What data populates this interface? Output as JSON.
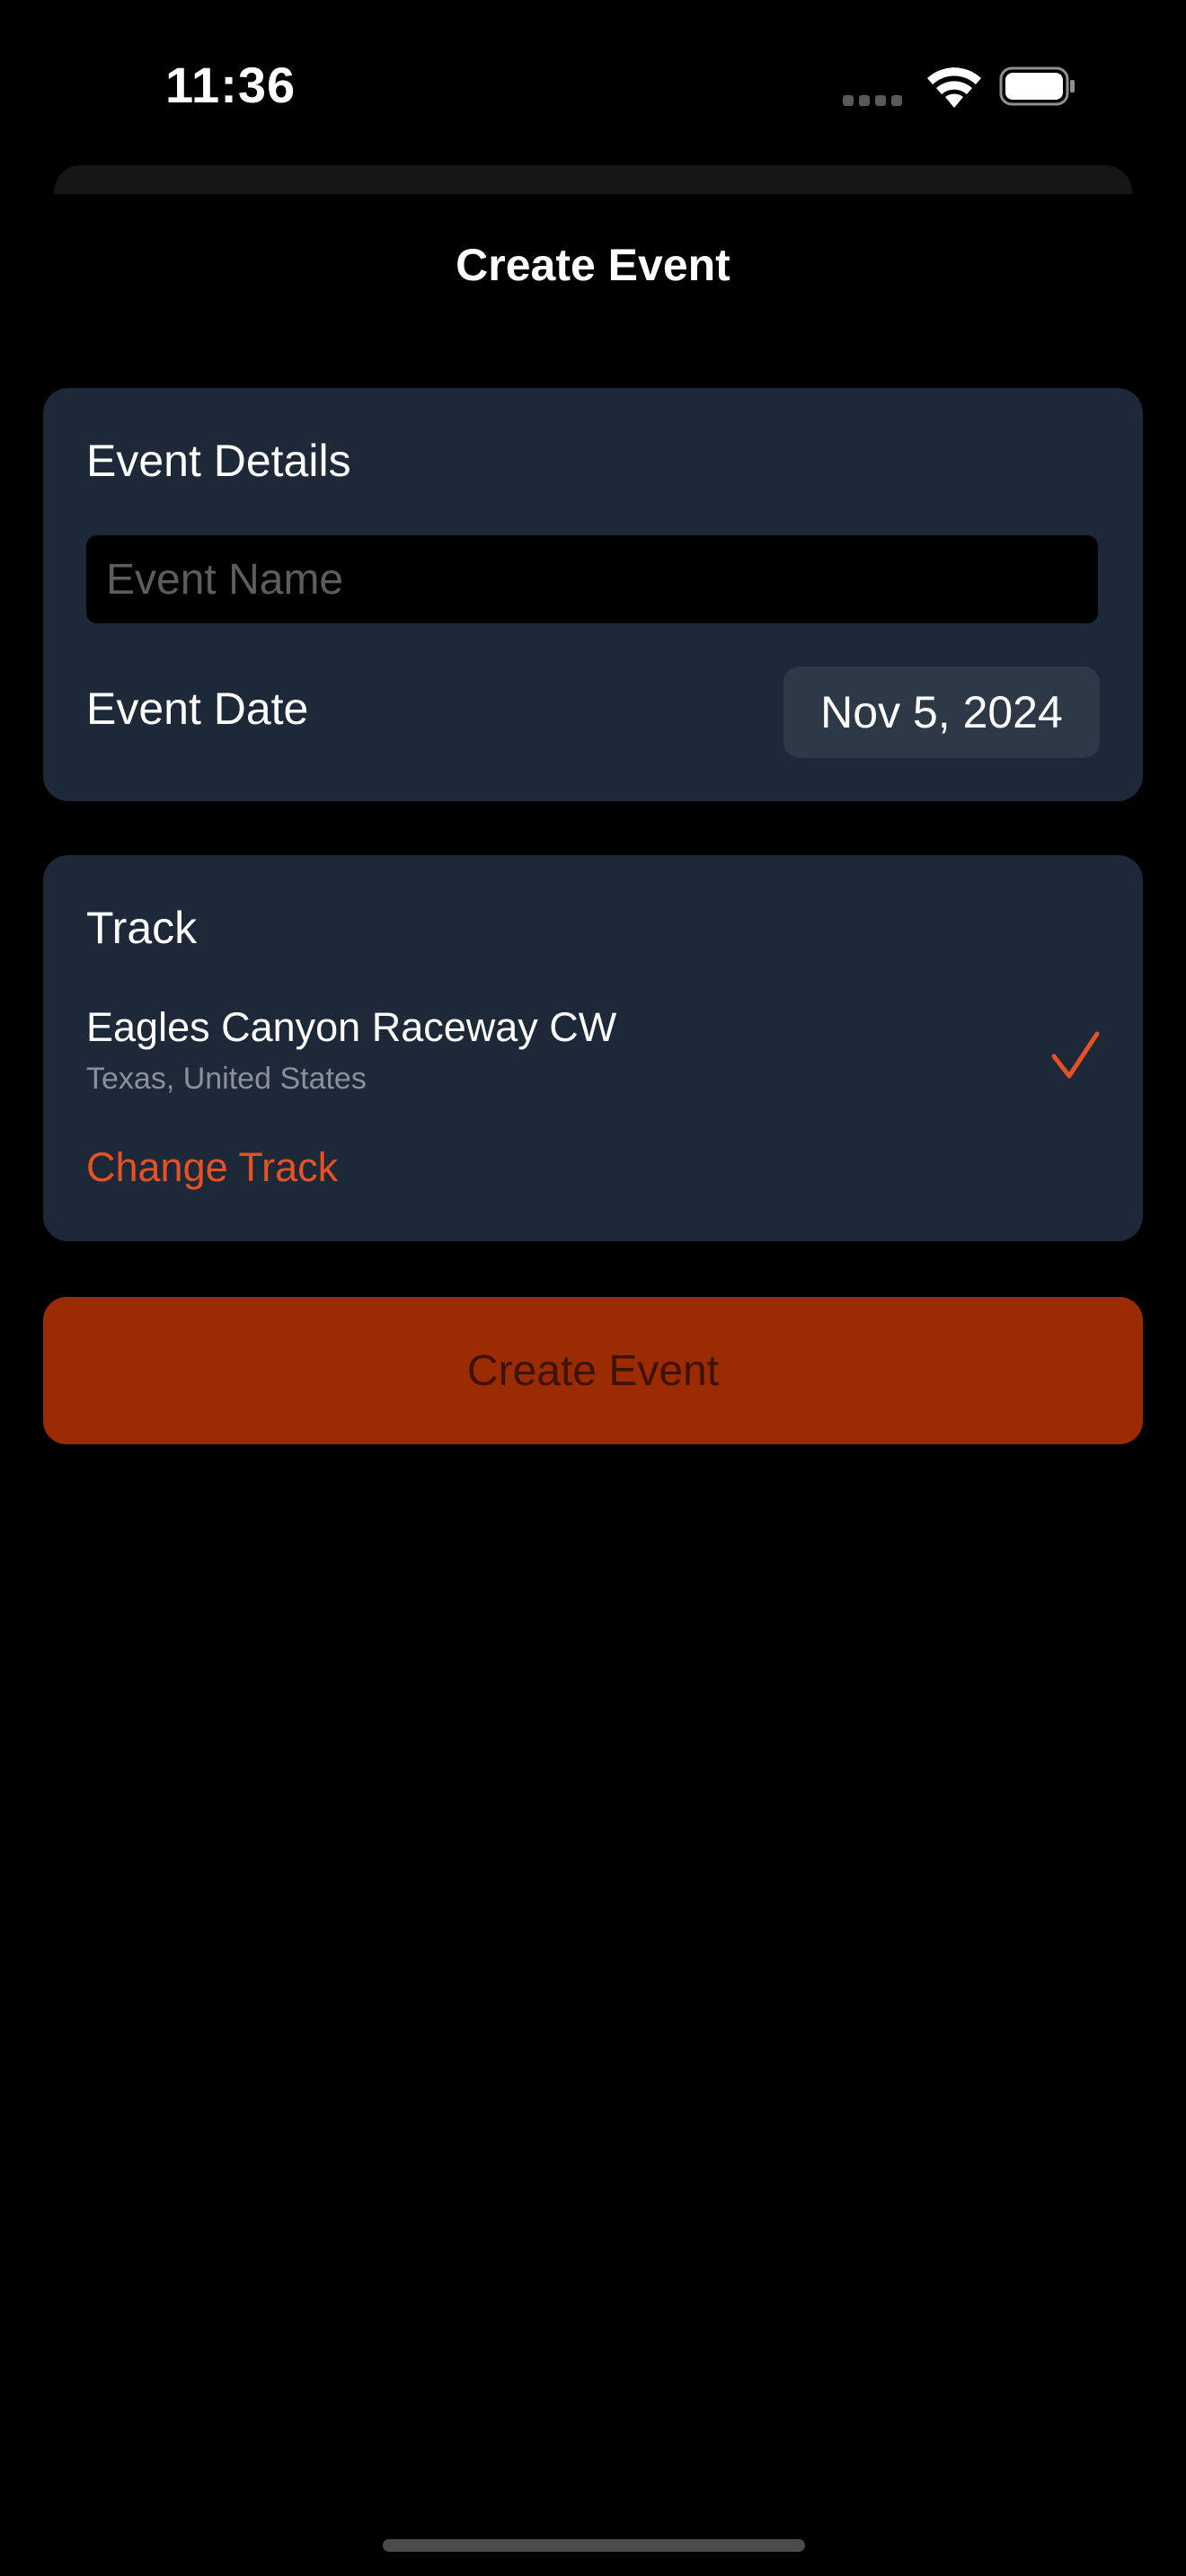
{
  "status_bar": {
    "time": "11:36",
    "icons": [
      "cellular-signal-icon",
      "wifi-icon",
      "battery-icon"
    ]
  },
  "nav": {
    "title": "Create Event"
  },
  "event_details": {
    "heading": "Event Details",
    "name_field": {
      "value": "",
      "placeholder": "Event Name"
    },
    "date_label": "Event Date",
    "date_value": "Nov 5, 2024"
  },
  "track": {
    "heading": "Track",
    "selected_name": "Eagles Canyon Raceway CW",
    "selected_location": "Texas, United States",
    "selected_icon": "checkmark-icon",
    "change_label": "Change Track"
  },
  "actions": {
    "create_label": "Create Event"
  },
  "colors": {
    "background": "#000000",
    "card": "#1d2838",
    "accent": "#e65224",
    "button_fill": "#9a2b03",
    "button_text": "#3e1204",
    "date_pill": "#2e3947",
    "secondary_text": "#8b9099",
    "placeholder_text": "#5d5d60"
  }
}
